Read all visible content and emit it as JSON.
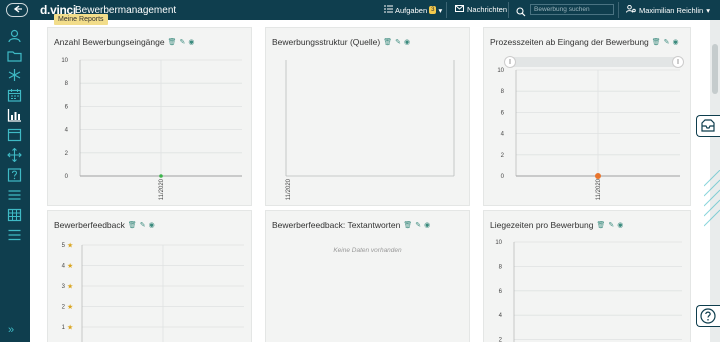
{
  "header": {
    "back_icon": "back-arrow-icon",
    "brand": "d.vinci",
    "app_title": "Bewerbermanagement",
    "tooltip": "Meine Reports",
    "tasks_label": "Aufgaben",
    "tasks_count": "3",
    "messages_label": "Nachrichten",
    "search_placeholder": "Bewerbung suchen",
    "user_name": "Maximilian Reichlin"
  },
  "sidebar": {
    "items": [
      "user-icon",
      "folder-icon",
      "asterisk-icon",
      "calendar-icon",
      "chart-icon",
      "browser-window-icon",
      "move-icon",
      "question-icon",
      "list-icon",
      "table-icon",
      "menu-icon"
    ],
    "expand_label": "»"
  },
  "cards": [
    {
      "title": "Anzahl Bewerbungseingänge",
      "chart_data": {
        "type": "scatter",
        "x": [
          "11/2020"
        ],
        "y": [
          0
        ],
        "ylim": [
          0,
          10
        ],
        "yticks": [
          0,
          2,
          4,
          6,
          8,
          10
        ],
        "color": "#3cb44b",
        "grid": true
      }
    },
    {
      "title": "Bewerbungsstruktur (Quelle)",
      "chart_data": {
        "type": "bar",
        "categories": [
          "11/2020"
        ],
        "values": [],
        "grid": false
      }
    },
    {
      "title": "Prozesszeiten ab Eingang der Bewerbung",
      "chart_data": {
        "type": "scatter",
        "x": [
          "11/2020"
        ],
        "y": [
          0
        ],
        "ylim": [
          0,
          10
        ],
        "yticks": [
          0,
          2,
          4,
          6,
          8,
          10
        ],
        "color": "#e8742c",
        "grid": true
      }
    },
    {
      "title": "Bewerberfeedback",
      "chart_data": {
        "type": "scatter",
        "yticks": [
          "1",
          "2",
          "3",
          "4",
          "5"
        ],
        "ytick_suffix": "star-icon",
        "x": [],
        "y": [],
        "color": "#3b8fd9",
        "grid": true
      }
    },
    {
      "title": "Bewerberfeedback: Textantworten",
      "no_data": "Keine Daten vorhanden"
    },
    {
      "title": "Liegezeiten pro Bewerbung",
      "chart_data": {
        "type": "bar",
        "yticks": [
          2,
          4,
          6,
          8,
          10
        ],
        "categories": [],
        "values": [],
        "grid": true
      }
    }
  ],
  "card_icons": [
    "trash-icon",
    "edit-icon",
    "eye-icon"
  ],
  "right_rail": {
    "buttons": [
      "inbox-icon",
      "help-icon"
    ]
  }
}
